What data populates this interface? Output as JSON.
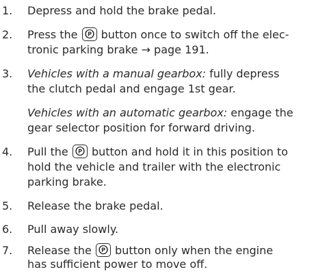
{
  "steps": [
    {
      "num": "1.",
      "text": "Depress and hold the brake pedal."
    },
    {
      "num": "2.",
      "pre": "Press the",
      "post": "button once to switch off the elec-",
      "line2": "tronic parking brake → page 191."
    },
    {
      "num": "3.",
      "italic": "Vehicles with a manual gearbox:",
      "line1_rest": "fully depress",
      "line2": "the clutch pedal and engage 1st gear."
    },
    {
      "italic": "Vehicles with an automatic gearbox:",
      "line1_rest": "engage the",
      "line2": "gear selector position for forward driving."
    },
    {
      "num": "4.",
      "pre": "Pull the",
      "post": "button and hold it in this position to",
      "line2": "hold the vehicle and trailer with the electronic",
      "line3": "parking brake."
    },
    {
      "num": "5.",
      "text": "Release the brake pedal."
    },
    {
      "num": "6.",
      "text": "Pull away slowly."
    },
    {
      "num": "7.",
      "pre": "Release the",
      "post": "button only when the engine",
      "line2": "has sufficient power to move off."
    }
  ],
  "icons": {
    "parking_button": "parking-brake-button-icon"
  }
}
